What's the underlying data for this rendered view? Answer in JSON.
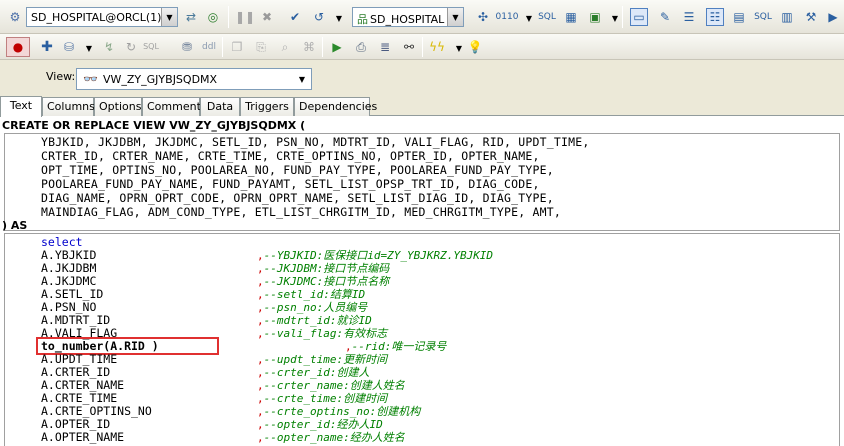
{
  "toolbar": {
    "connection": "SD_HOSPITAL@ORCL(1)",
    "schema": "SD_HOSPITAL"
  },
  "view_selector": {
    "label": "View:",
    "value": "VW_ZY_GJYBJSQDMX"
  },
  "tabs": [
    "Text",
    "Columns",
    "Options",
    "Comment",
    "Data",
    "Triggers",
    "Dependencies"
  ],
  "editor": {
    "header": "CREATE OR REPLACE VIEW VW_ZY_GJYBJSQDMX (",
    "field_lines": [
      "YBJKID, JKJDBM, JKJDMC, SETL_ID, PSN_NO, MDTRT_ID, VALI_FLAG, RID, UPDT_TIME,",
      "CRTER_ID, CRTER_NAME, CRTE_TIME, CRTE_OPTINS_NO, OPTER_ID, OPTER_NAME,",
      "OPT_TIME, OPTINS_NO, POOLAREA_NO, FUND_PAY_TYPE, POOLAREA_FUND_PAY_TYPE,",
      "POOLAREA_FUND_PAY_NAME, FUND_PAYAMT, SETL_LIST_OPSP_TRT_ID, DIAG_CODE,",
      "DIAG_NAME, OPRN_OPRT_CODE, OPRN_OPRT_NAME, SETL_LIST_DIAG_ID, DIAG_TYPE,",
      "MAINDIAG_FLAG, ADM_COND_TYPE, ETL_LIST_CHRGITM_ID, MED_CHRGITM_TYPE, AMT,"
    ],
    "as_line": ") AS",
    "select_kw": "select",
    "rows": [
      {
        "code": "A.YBJKID",
        "comment": "--YBJKID:医保接口id=ZY_YBJKRZ.YBJKID"
      },
      {
        "code": "A.JKJDBM",
        "comment": "--JKJDBM:接口节点编码"
      },
      {
        "code": "A.JKJDMC",
        "comment": "--JKJDMC:接口节点名称"
      },
      {
        "code": "A.SETL_ID",
        "comment": "--setl_id:结算ID"
      },
      {
        "code": "A.PSN_NO",
        "comment": "--psn_no:人员编号"
      },
      {
        "code": "A.MDTRT_ID",
        "comment": "--mdtrt_id:就诊ID"
      },
      {
        "code": "A.VALI_FLAG",
        "comment": "--vali_flag:有效标志"
      },
      {
        "code": "to_number(A.RID )",
        "comment": "--rid:唯一记录号"
      },
      {
        "code": "A.UPDT_TIME",
        "comment": "--updt_time:更新时间"
      },
      {
        "code": "A.CRTER_ID",
        "comment": "--crter_id:创建人"
      },
      {
        "code": "A.CRTER_NAME",
        "comment": "--crter_name:创建人姓名"
      },
      {
        "code": "A.CRTE_TIME",
        "comment": "--crte_time:创建时间"
      },
      {
        "code": "A.CRTE_OPTINS_NO",
        "comment": "--crte_optins_no:创建机构"
      },
      {
        "code": "A.OPTER_ID",
        "comment": "--opter_id:经办人ID"
      },
      {
        "code": "A.OPTER_NAME",
        "comment": "--opter_name:经办人姓名"
      }
    ]
  }
}
